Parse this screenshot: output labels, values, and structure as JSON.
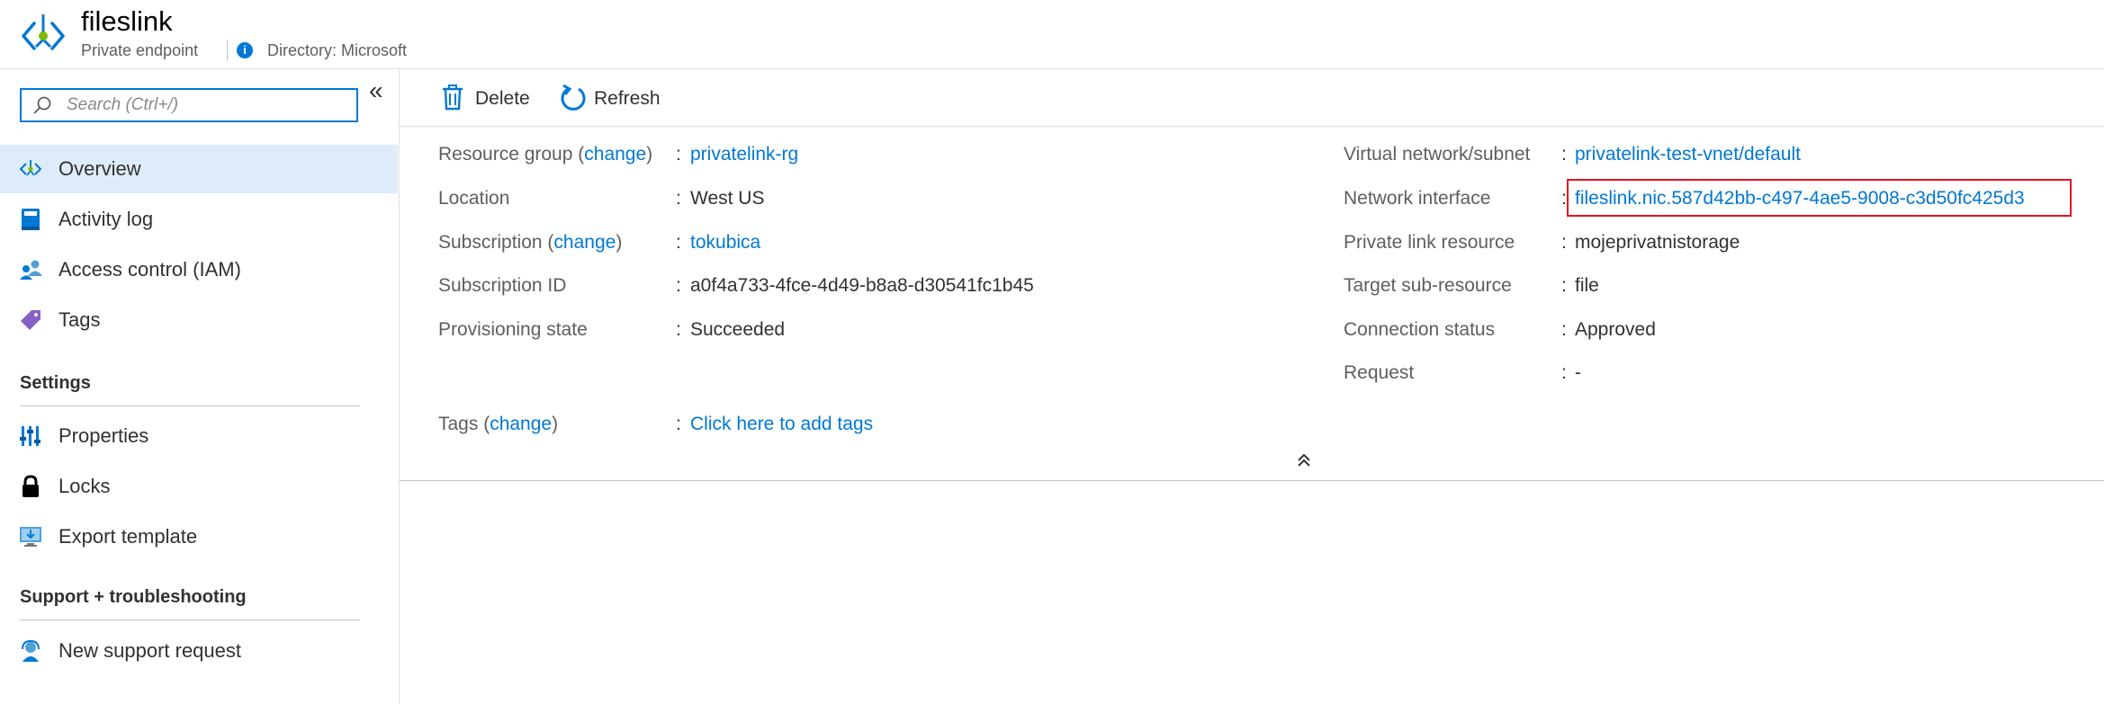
{
  "header": {
    "title": "fileslink",
    "subtitle": "Private endpoint",
    "directory": "Directory: Microsoft",
    "info_icon": "info-icon",
    "resource_icon": "private-endpoint-icon"
  },
  "sidebar": {
    "search_placeholder": "Search (Ctrl+/)",
    "collapse_glyph": "«",
    "items": [
      {
        "label": "Overview",
        "icon": "overview-icon",
        "active": true
      },
      {
        "label": "Activity log",
        "icon": "activity-log-icon"
      },
      {
        "label": "Access control (IAM)",
        "icon": "iam-icon"
      },
      {
        "label": "Tags",
        "icon": "tag-icon"
      }
    ],
    "settings_header": "Settings",
    "settings_items": [
      {
        "label": "Properties",
        "icon": "properties-icon"
      },
      {
        "label": "Locks",
        "icon": "lock-icon"
      },
      {
        "label": "Export template",
        "icon": "export-template-icon"
      }
    ],
    "support_header": "Support + troubleshooting",
    "support_items": [
      {
        "label": "New support request",
        "icon": "support-request-icon"
      }
    ]
  },
  "toolbar": {
    "delete_label": "Delete",
    "refresh_label": "Refresh"
  },
  "essentials": {
    "left": {
      "resource_group": {
        "label": "Resource group",
        "change": "change",
        "value": "privatelink-rg"
      },
      "location": {
        "label": "Location",
        "value": "West US"
      },
      "subscription": {
        "label": "Subscription",
        "change": "change",
        "value": "tokubica"
      },
      "subscription_id": {
        "label": "Subscription ID",
        "value": "a0f4a733-4fce-4d49-b8a8-d30541fc1b45"
      },
      "provisioning_state": {
        "label": "Provisioning state",
        "value": "Succeeded"
      },
      "tags": {
        "label": "Tags",
        "change": "change",
        "value": "Click here to add tags"
      }
    },
    "right": {
      "vnet_subnet": {
        "label": "Virtual network/subnet",
        "value": "privatelink-test-vnet/default"
      },
      "network_interface": {
        "label": "Network interface",
        "value": "fileslink.nic.587d42bb-c497-4ae5-9008-c3d50fc425d3"
      },
      "private_link_resource": {
        "label": "Private link resource",
        "value": "mojeprivatnistorage"
      },
      "target_sub_resource": {
        "label": "Target sub-resource",
        "value": "file"
      },
      "connection_status": {
        "label": "Connection status",
        "value": "Approved"
      },
      "request": {
        "label": "Request",
        "value": "-"
      }
    },
    "colon": ":",
    "paren_open": "(",
    "paren_close": ")"
  },
  "colors": {
    "accent": "#0078d4",
    "highlight_border": "#e81123",
    "active_nav_bg": "#deecf9"
  }
}
